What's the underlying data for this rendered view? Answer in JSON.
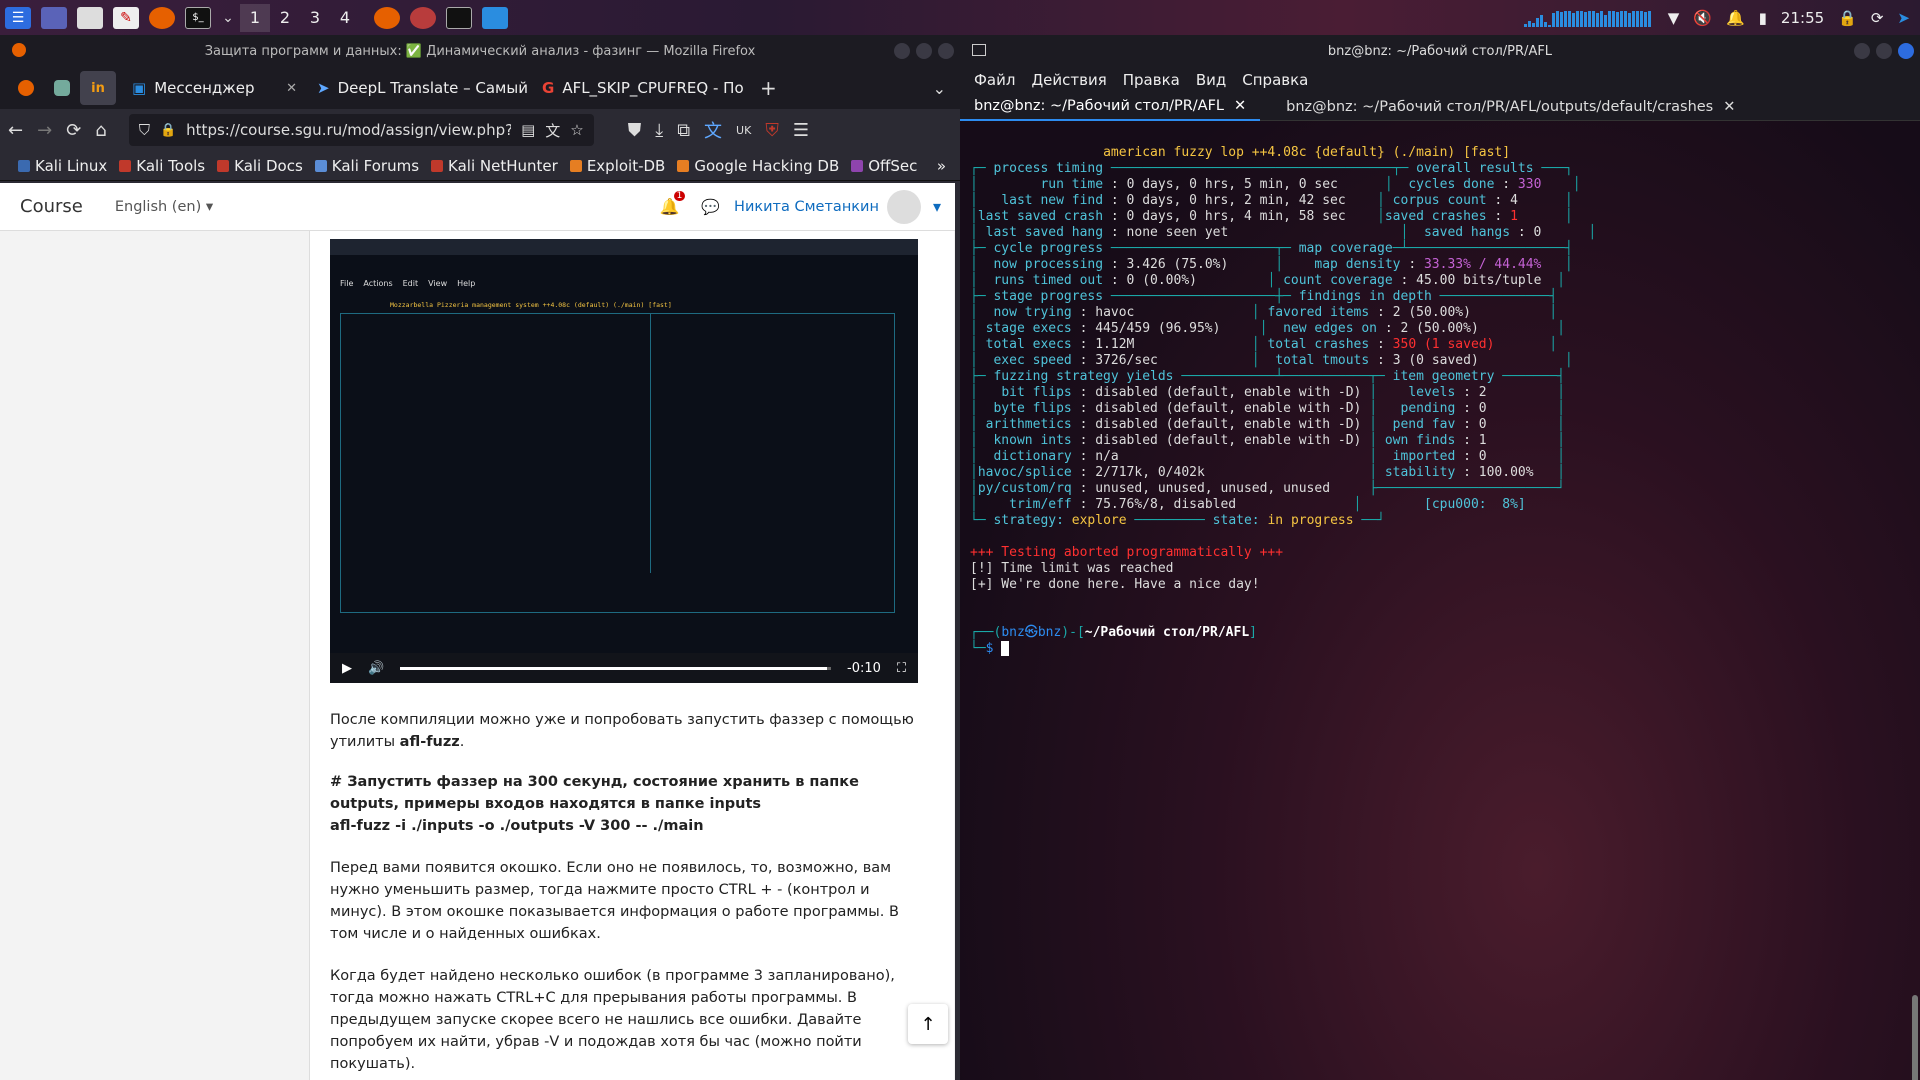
{
  "taskbar": {
    "workspaces": [
      "1",
      "2",
      "3",
      "4"
    ],
    "clock": "21:55"
  },
  "firefox": {
    "window_title": "Защита программ и данных: ✅ Динамический анализ - фазинг — Mozilla Firefox",
    "tabs": [
      {
        "label": "Мессенджер",
        "icon": "messenger-icon"
      },
      {
        "label": "DeepL Translate – Самый",
        "icon": "deepl-icon"
      },
      {
        "label": "AFL_SKIP_CPUFREQ - По",
        "icon": "google-icon"
      }
    ],
    "url": "https://course.sgu.ru/mod/assign/view.php?id",
    "bookmarks": [
      "Kali Linux",
      "Kali Tools",
      "Kali Docs",
      "Kali Forums",
      "Kali NetHunter",
      "Exploit-DB",
      "Google Hacking DB",
      "OffSec"
    ],
    "moodle": {
      "brand": "Course",
      "language": "English (en)",
      "user_name": "Никита Сметанкин",
      "notif_count": "1"
    },
    "video": {
      "time": "-0:10",
      "progress": 0.99,
      "menu": [
        "File",
        "Actions",
        "Edit",
        "View",
        "Help"
      ],
      "title": "Mozzarbella Pizzeria management system ++4.08c (default) (./main) [fast]"
    },
    "paragraphs": {
      "p1": "После компиляции можно уже и попробовать запустить фаззер с помощью утилиты ",
      "p1_bold": "afl-fuzz",
      "p1_end": ".",
      "p2_line1": "# Запустить фаззер на 300 секунд, состояние хранить в папке outputs, примеры входов находятся в папке inputs",
      "p2_line2": "afl-fuzz -i ./inputs -o ./outputs -V 300 -- ./main",
      "p3": "Перед вами появится окошко. Если оно не появилось, то, возможно, вам нужно уменьшить размер, тогда нажмите просто CTRL + - (контрол и минус). В этом окошке показывается информация о работе программы. В том числе и о найденных ошибках.",
      "p4": "Когда будет найдено несколько ошибок (в программе 3 запланировано), тогда можно нажать CTRL+C для прерывания работы программы. В предыдущем запуске скорее всего не нашлись все ошибки. Давайте попробуем их найти, убрав -V и подождав хотя бы час (можно пойти покушать)."
    }
  },
  "terminal": {
    "window_title": "bnz@bnz: ~/Рабочий стол/PR/AFL",
    "menu": [
      "Файл",
      "Действия",
      "Правка",
      "Вид",
      "Справка"
    ],
    "tabs": [
      {
        "label": "bnz@bnz: ~/Рабочий стол/PR/AFL"
      },
      {
        "label": "bnz@bnz: ~/Рабочий стол/PR/AFL/outputs/default/crashes"
      }
    ],
    "afl": {
      "header": "american fuzzy lop ++4.08c {default} (./main) [fast]",
      "run_time": "0 days, 0 hrs, 5 min, 0 sec",
      "last_new_find": "0 days, 0 hrs, 2 min, 42 sec",
      "last_saved_crash": "0 days, 0 hrs, 4 min, 58 sec",
      "last_saved_hang": "none seen yet",
      "cycles_done": "330",
      "corpus_count": "4",
      "saved_crashes": "1",
      "saved_hangs": "0",
      "now_processing": "3.426 (75.0%)",
      "runs_timed_out": "0 (0.00%)",
      "map_density": "33.33% / 44.44%",
      "count_coverage": "45.00 bits/tuple",
      "now_trying": "havoc",
      "stage_execs": "445/459 (96.95%)",
      "total_execs": "1.12M",
      "exec_speed": "3726/sec",
      "favored_items": "2 (50.00%)",
      "new_edges_on": "2 (50.00%)",
      "total_crashes": "350 (1 saved)",
      "total_tmouts": "3 (0 saved)",
      "bit_flips": "disabled (default, enable with -D)",
      "byte_flips": "disabled (default, enable with -D)",
      "arithmetics": "disabled (default, enable with -D)",
      "known_ints": "disabled (default, enable with -D)",
      "dictionary": "n/a",
      "havoc_splice": "2/717k, 0/402k",
      "py_custom_rq": "unused, unused, unused, unused",
      "trim_eff": "75.76%/8, disabled",
      "levels": "2",
      "pending": "0",
      "pend_fav": "0",
      "own_finds": "1",
      "imported": "0",
      "stability": "100.00%",
      "cpu": "[cpu000:  8%]",
      "strategy": "explore",
      "state": "in progress"
    },
    "messages": [
      "+++ Testing aborted programmatically +++",
      "[!] Time limit was reached",
      "[+] We're done here. Have a nice day!"
    ],
    "prompt": {
      "user": "bnz",
      "host": "bnz",
      "path": "~/Рабочий стол/PR/AFL"
    }
  }
}
